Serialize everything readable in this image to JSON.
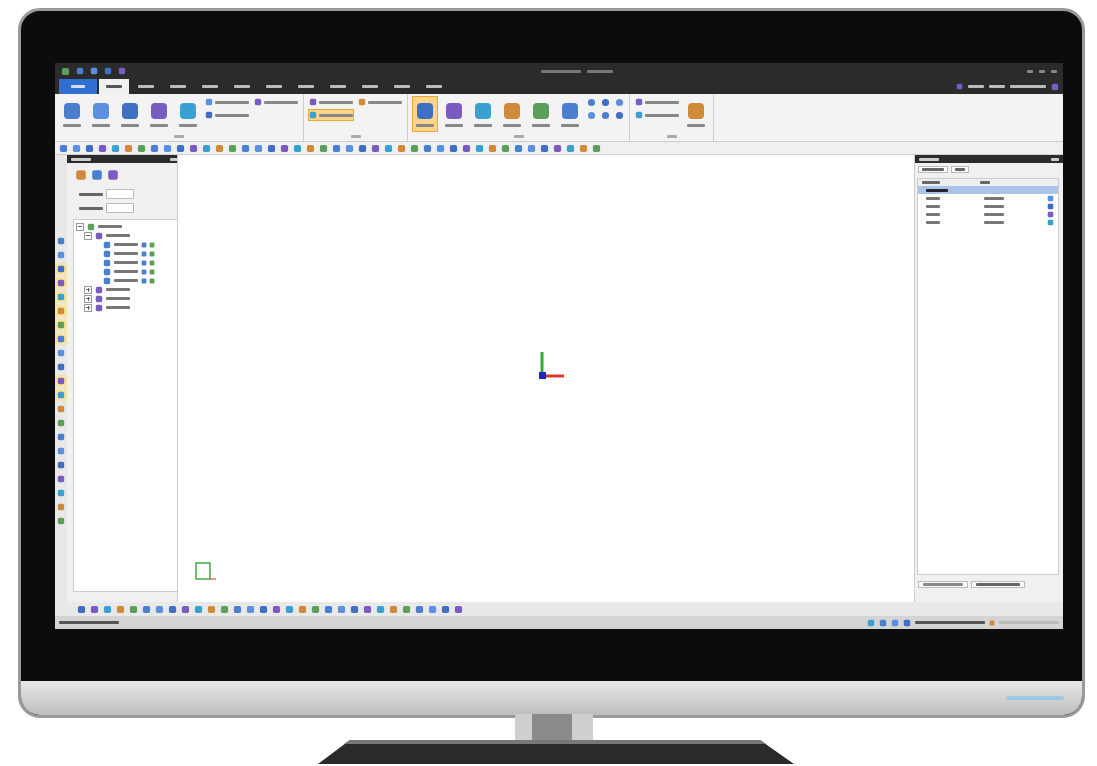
{
  "ribbon_tabs": [
    {
      "kind": "file",
      "selected": false
    },
    {
      "kind": "tab",
      "selected": true
    },
    {
      "kind": "tab",
      "selected": false
    },
    {
      "kind": "tab",
      "selected": false
    },
    {
      "kind": "tab",
      "selected": false
    },
    {
      "kind": "tab",
      "selected": false
    },
    {
      "kind": "tab",
      "selected": false
    },
    {
      "kind": "tab",
      "selected": false
    },
    {
      "kind": "tab",
      "selected": false
    },
    {
      "kind": "tab",
      "selected": false
    },
    {
      "kind": "tab",
      "selected": false
    },
    {
      "kind": "tab",
      "selected": false
    }
  ],
  "ribbon_groups": [
    {
      "buttons": [
        {
          "kind": "large",
          "selected": false
        },
        {
          "kind": "large",
          "selected": false
        },
        {
          "kind": "large",
          "selected": false
        },
        {
          "kind": "large",
          "selected": false
        },
        {
          "kind": "large",
          "selected": false
        },
        {
          "kind": "small",
          "selected": false
        },
        {
          "kind": "small",
          "selected": false
        },
        {
          "kind": "small",
          "selected": false
        }
      ]
    },
    {
      "buttons": [
        {
          "kind": "small",
          "selected": false
        },
        {
          "kind": "small",
          "selected": true
        },
        {
          "kind": "small",
          "selected": false
        }
      ]
    },
    {
      "buttons": [
        {
          "kind": "large",
          "selected": true
        },
        {
          "kind": "large",
          "selected": false
        },
        {
          "kind": "large",
          "selected": false
        },
        {
          "kind": "large",
          "selected": false
        },
        {
          "kind": "large",
          "selected": false
        },
        {
          "kind": "large",
          "selected": false
        },
        {
          "kind": "dot",
          "selected": false
        },
        {
          "kind": "dot",
          "selected": false
        },
        {
          "kind": "dot",
          "selected": false
        },
        {
          "kind": "dot",
          "selected": false
        },
        {
          "kind": "dot",
          "selected": false
        },
        {
          "kind": "dot",
          "selected": false
        }
      ]
    },
    {
      "buttons": [
        {
          "kind": "small",
          "selected": false
        },
        {
          "kind": "small",
          "selected": false
        },
        {
          "kind": "large",
          "selected": false
        }
      ]
    }
  ],
  "left_tools": [
    {
      "active": false
    },
    {
      "active": false
    },
    {
      "active": true
    },
    {
      "active": true
    },
    {
      "active": true
    },
    {
      "active": true
    },
    {
      "active": true
    },
    {
      "active": true
    },
    {
      "active": false
    },
    {
      "active": false
    },
    {
      "active": true
    },
    {
      "active": true
    },
    {
      "active": false
    },
    {
      "active": false
    },
    {
      "active": false
    },
    {
      "active": false
    },
    {
      "active": false
    },
    {
      "active": false
    },
    {
      "active": false
    },
    {
      "active": false
    },
    {
      "active": false
    }
  ],
  "tree": [
    {
      "expanded": true,
      "children": [
        {
          "expanded": true,
          "children": [
            {
              "kind": "leaf"
            },
            {
              "kind": "leaf"
            },
            {
              "kind": "leaf"
            },
            {
              "kind": "leaf"
            },
            {
              "kind": "leaf"
            }
          ]
        },
        {
          "expanded": false
        },
        {
          "expanded": false
        },
        {
          "expanded": false
        }
      ]
    }
  ],
  "property_rows": [
    {
      "kind": "group",
      "selected": true
    },
    {
      "kind": "row",
      "selected": false
    },
    {
      "kind": "row",
      "selected": false
    },
    {
      "kind": "row",
      "selected": false
    },
    {
      "kind": "row",
      "selected": false
    }
  ]
}
